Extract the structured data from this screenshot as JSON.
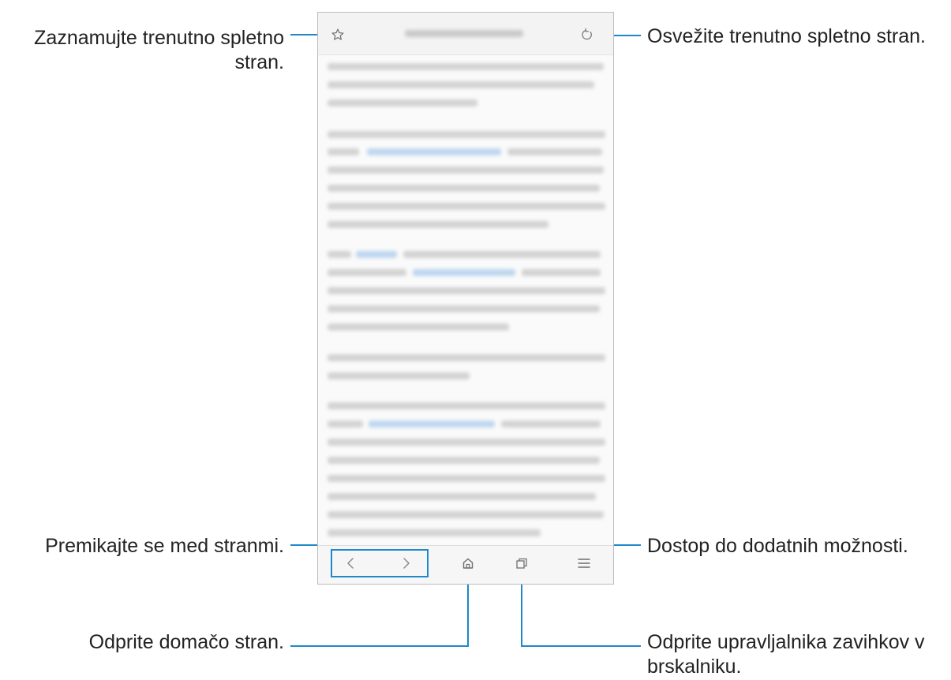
{
  "annotations": {
    "bookmark": {
      "line1": "Zaznamujte trenutno spletno",
      "line2": "stran."
    },
    "refresh": "Osvežite trenutno spletno stran.",
    "navigate": "Premikajte se med stranmi.",
    "more_options": "Dostop do dodatnih možnosti.",
    "home": "Odprite domačo stran.",
    "tabs": {
      "line1": "Odprite upravljalnika zavihkov v",
      "line2": "brskalniku."
    }
  },
  "browser": {
    "top_icons": {
      "bookmark": "star-outline-icon",
      "refresh": "refresh-icon"
    },
    "bottom_icons": {
      "back": "chevron-left-icon",
      "forward": "chevron-right-icon",
      "home": "home-icon",
      "tabs": "tabs-icon",
      "menu": "menu-icon"
    }
  },
  "colors": {
    "callout": "#1e88c8",
    "link_blur": "#b8d3ee"
  }
}
